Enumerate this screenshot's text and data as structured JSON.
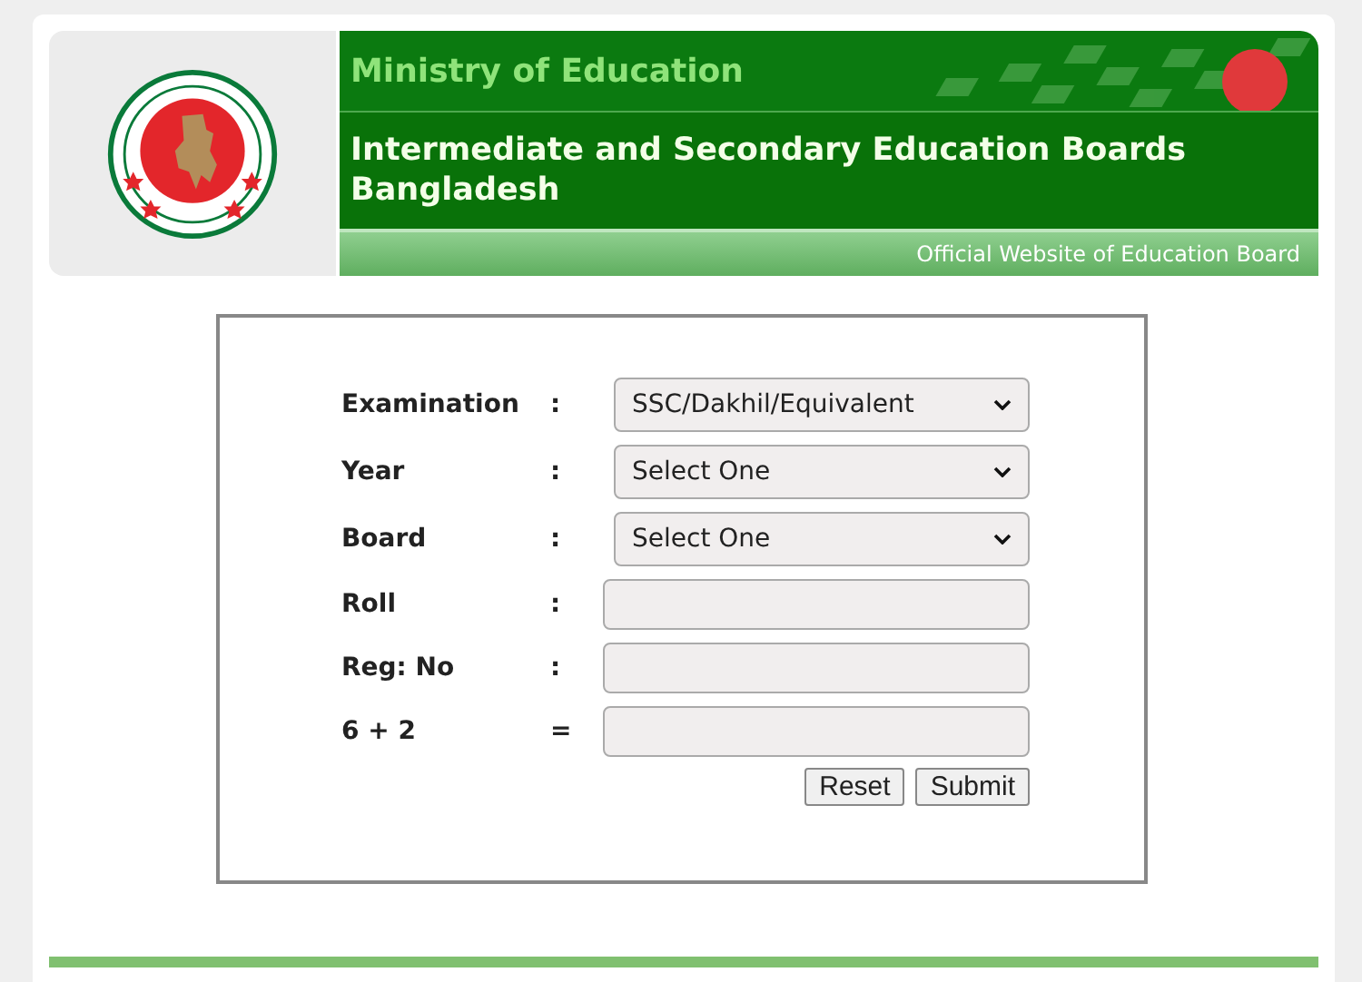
{
  "header": {
    "ministry": "Ministry of Education",
    "title": "Intermediate and Secondary Education Boards Bangladesh",
    "tagline": "Official Website of Education Board"
  },
  "form": {
    "rows": [
      {
        "label": "Examination",
        "separator": ":",
        "kind": "select",
        "value": "SSC/Dakhil/Equivalent"
      },
      {
        "label": "Year",
        "separator": ":",
        "kind": "select",
        "value": "Select One"
      },
      {
        "label": "Board",
        "separator": ":",
        "kind": "select",
        "value": "Select One"
      },
      {
        "label": "Roll",
        "separator": ":",
        "kind": "input"
      },
      {
        "label": "Reg: No",
        "separator": ":",
        "kind": "input"
      },
      {
        "label": "6 + 2",
        "separator": "=",
        "kind": "input"
      }
    ],
    "buttons": [
      "Reset",
      "Submit"
    ]
  }
}
